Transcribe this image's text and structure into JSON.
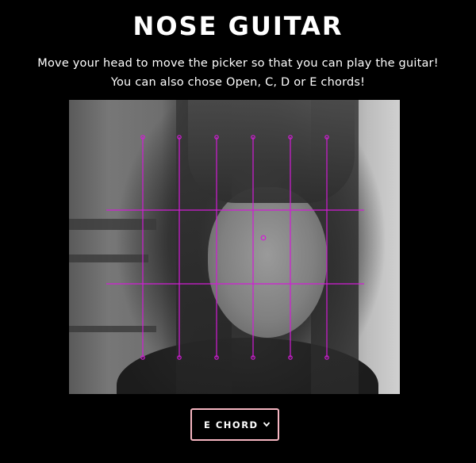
{
  "header": {
    "title": "NOSE GUITAR",
    "line1": "Move your head to move the picker so that you can play the guitar!",
    "line2": "You can also chose Open, C, D or E chords!"
  },
  "guitar_overlay": {
    "color": "#d21cd6",
    "strings": 6,
    "frets": 2
  },
  "chord_select": {
    "selected": "E CHORD",
    "icon": "chevron-down-icon"
  }
}
